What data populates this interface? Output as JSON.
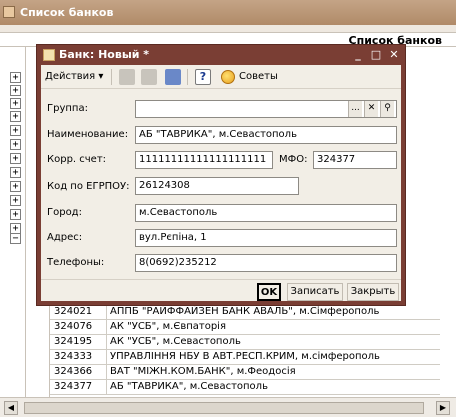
{
  "outer": {
    "title": "Список банков",
    "column_header": "Список банков",
    "rows": [
      {
        "code": "324021",
        "name": "АППБ \"РАЙФФАЙЗЕН БАНК АВАЛЬ\", м.Сімферополь"
      },
      {
        "code": "324076",
        "name": "АК \"УСБ\", м.Євпаторія"
      },
      {
        "code": "324195",
        "name": "АК \"УСБ\", м.Севастополь"
      },
      {
        "code": "324333",
        "name": "УПРАВЛІННЯ НБУ В АВТ.РЕСП.КРИМ, м.сімферополь"
      },
      {
        "code": "324366",
        "name": "ВАТ \"МІЖН.КОМ.БАНК\", м.Феодосія"
      },
      {
        "code": "324377",
        "name": "АБ \"ТАВРИКА\", м.Севастополь"
      }
    ],
    "tree_expand": "+",
    "tree_collapse": "−"
  },
  "dialog": {
    "title": "Банк: Новый *",
    "controls": {
      "minimize": "_",
      "maximize": "□",
      "close": "✕"
    },
    "toolbar": {
      "actions_label": "Действия ▾",
      "help_label": "?",
      "sovety_label": "Советы"
    },
    "form": {
      "group_label": "Группа:",
      "group_value": "",
      "group_btn_select": "...",
      "group_btn_clear": "✕",
      "group_btn_find": "⚲",
      "name_label": "Наименование:",
      "name_value": "АБ \"ТАВРИКА\", м.Севастополь",
      "corr_label": "Корр. счет:",
      "corr_value": "11111111111111111111",
      "mfo_label": "МФО:",
      "mfo_value": "324377",
      "egrpou_label": "Код по ЕГРПОУ:",
      "egrpou_value": "26124308",
      "city_label": "Город:",
      "city_value": "м.Севастополь",
      "address_label": "Адрес:",
      "address_value": "вул.Рєпіна, 1",
      "phone_label": "Телефоны:",
      "phone_value": "8(0692)235212"
    },
    "footer": {
      "ok_label": "OK",
      "save_label": "Записать",
      "close_label": "Закрыть"
    }
  },
  "colors": {
    "dialog_frame": "#7a3e34",
    "outer_title": "#b08a68",
    "form_bg": "#f2eee6"
  }
}
